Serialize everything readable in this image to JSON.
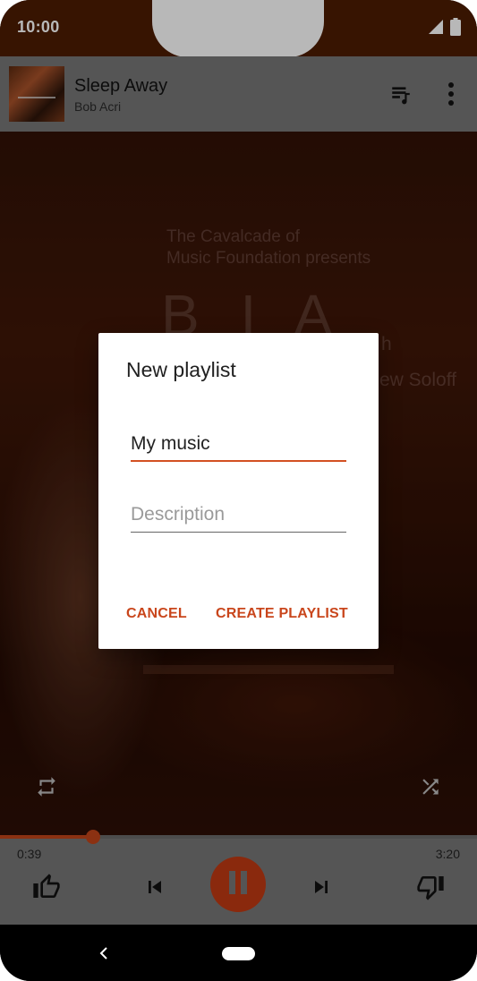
{
  "status_bar": {
    "time": "10:00",
    "icons": [
      "signal-icon",
      "battery-icon"
    ]
  },
  "now_playing": {
    "title": "Sleep Away",
    "artist": "Bob Acri",
    "actions": [
      "queue-music-icon",
      "more-vert-icon"
    ]
  },
  "album_art": {
    "lines": [
      "The Cavalcade of",
      "Music Foundation presents"
    ],
    "big": "B I A",
    "right_fragment": "ew Soloff",
    "small_fragment": "h"
  },
  "playback": {
    "elapsed": "0:39",
    "total": "3:20",
    "progress_fraction": 0.195,
    "state": "playing"
  },
  "dialog": {
    "title": "New playlist",
    "name_value": "My music",
    "description_placeholder": "Description",
    "cancel_label": "CANCEL",
    "create_label": "CREATE PLAYLIST"
  },
  "colors": {
    "accent": "#c9461c",
    "status_bar": "#4d1c02",
    "play_button": "#bf3a13"
  }
}
